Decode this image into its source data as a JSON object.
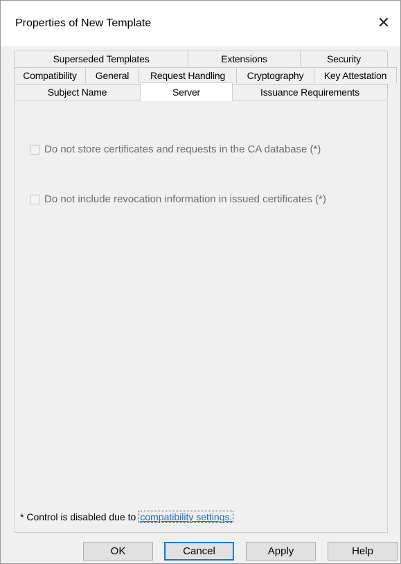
{
  "window": {
    "title": "Properties of New Template",
    "close_glyph": "✕"
  },
  "tabs": {
    "row1": [
      "Superseded Templates",
      "Extensions",
      "Security"
    ],
    "row2": [
      "Compatibility",
      "General",
      "Request Handling",
      "Cryptography",
      "Key Attestation"
    ],
    "row3": [
      "Subject Name",
      "Server",
      "Issuance Requirements"
    ],
    "active": "Server"
  },
  "options": {
    "no_store": {
      "label": "Do not store certificates and requests in the CA database (*)",
      "checked": false,
      "enabled": false
    },
    "no_revocation": {
      "label": "Do not include revocation information in issued certificates (*)",
      "checked": false,
      "enabled": false
    }
  },
  "footer_note": {
    "text": "* Control is disabled due to",
    "link": "compatibility settings."
  },
  "buttons": {
    "ok": "OK",
    "cancel": "Cancel",
    "apply": "Apply",
    "help": "Help"
  }
}
